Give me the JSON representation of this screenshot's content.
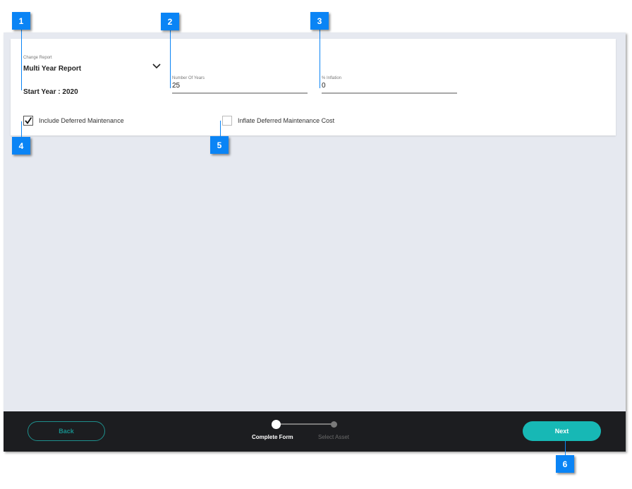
{
  "form": {
    "change_report_label": "Change Report",
    "report_selected": "Multi Year Report",
    "start_year_text": "Start Year : 2020",
    "number_of_years": {
      "label": "Number Of Years",
      "value": "25"
    },
    "inflation": {
      "label": "% Inflation",
      "value": "0"
    },
    "include_deferred": {
      "label": "Include Deferred Maintenance",
      "checked": true
    },
    "inflate_deferred": {
      "label": "Inflate Deferred Maintenance Cost",
      "checked": false
    }
  },
  "footer": {
    "back_label": "Back",
    "next_label": "Next",
    "steps": [
      {
        "label": "Complete Form",
        "active": true
      },
      {
        "label": "Select Asset",
        "active": false
      }
    ]
  },
  "callouts": [
    "1",
    "2",
    "3",
    "4",
    "5",
    "6"
  ],
  "colors": {
    "accent": "#17b8b5",
    "callout": "#0a84f5",
    "footer_bg": "#1c1d20",
    "panel_bg": "#e6e9f0"
  }
}
